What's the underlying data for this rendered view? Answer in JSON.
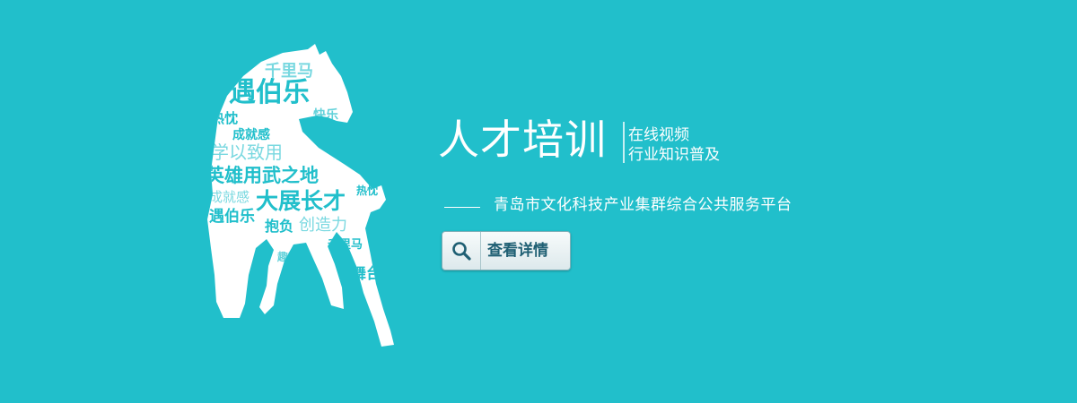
{
  "banner": {
    "title": "人才培训",
    "subtitle_line1": "在线视频",
    "subtitle_line2": "行业知识普及",
    "organization": "青岛市文化科技产业集群综合公共服务平台",
    "button_label": "查看详情",
    "button_icon": "search-icon",
    "colors": {
      "background": "#21bfcb",
      "horse": "#ffffff",
      "button_text": "#1f5f73"
    }
  },
  "horse_words": {
    "w1": "千里马",
    "w2": "遇伯乐",
    "w3": "热忱",
    "w4": "快乐",
    "w5": "成就感",
    "w6": "学以致用",
    "w7": "英雄用武之地",
    "w8": "成就感",
    "w9": "大展长才",
    "w10": "遇伯乐",
    "w11": "抱负",
    "w12": "创造力",
    "w13": "千里马",
    "w14": "热忱",
    "w15": "舞台",
    "w16": "趣味"
  }
}
